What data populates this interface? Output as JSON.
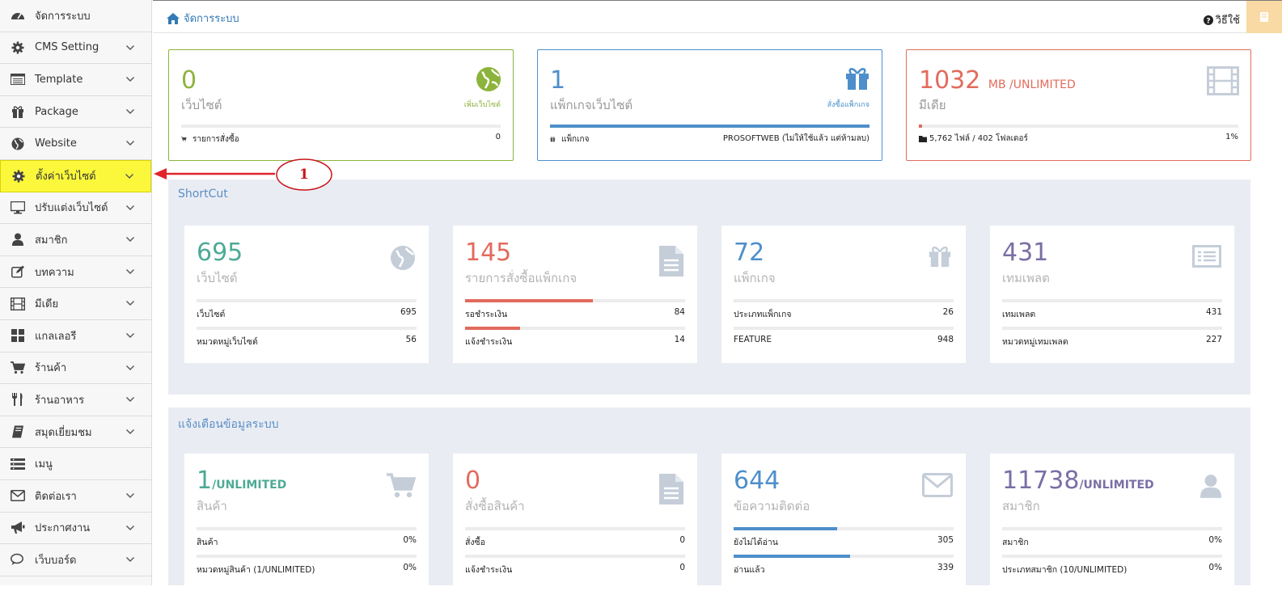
{
  "sidebar": {
    "items": [
      {
        "label": "จัดการระบบ",
        "icon": "dashboard-icon",
        "chevron": false
      },
      {
        "label": "CMS Setting",
        "icon": "gear-icon",
        "chevron": true
      },
      {
        "label": "Template",
        "icon": "template-list-icon",
        "chevron": true
      },
      {
        "label": "Package",
        "icon": "gift-icon",
        "chevron": true
      },
      {
        "label": "Website",
        "icon": "globe-icon",
        "chevron": true
      },
      {
        "label": "ตั้งค่าเว็บไซต์",
        "icon": "gear-icon",
        "chevron": true,
        "active": true
      },
      {
        "label": "ปรับแต่งเว็บไซต์",
        "icon": "monitor-icon",
        "chevron": true
      },
      {
        "label": "สมาชิก",
        "icon": "user-icon",
        "chevron": true
      },
      {
        "label": "บทความ",
        "icon": "edit-icon",
        "chevron": true
      },
      {
        "label": "มีเดีย",
        "icon": "film-icon",
        "chevron": true
      },
      {
        "label": "แกลเลอรี",
        "icon": "grid-icon",
        "chevron": true
      },
      {
        "label": "ร้านค้า",
        "icon": "cart-icon",
        "chevron": true
      },
      {
        "label": "ร้านอาหาร",
        "icon": "utensils-icon",
        "chevron": true
      },
      {
        "label": "สมุดเยี่ยมชม",
        "icon": "book-icon",
        "chevron": true
      },
      {
        "label": "เมนู",
        "icon": "menu-icon",
        "chevron": false
      },
      {
        "label": "ติดต่อเรา",
        "icon": "envelope-icon",
        "chevron": true
      },
      {
        "label": "ประกาศงาน",
        "icon": "megaphone-icon",
        "chevron": true
      },
      {
        "label": "เว็บบอร์ด",
        "icon": "comments-icon",
        "chevron": true
      }
    ]
  },
  "topbar": {
    "breadcrumb": "จัดการระบบ",
    "help": "วิธีใช้"
  },
  "callout": {
    "number": "1"
  },
  "top_cards": [
    {
      "value": "0",
      "unit": "",
      "label": "เว็บไซต์",
      "action": "เพิ่มเว็บไซต์",
      "foot_left": "รายการสั่งซื้อ",
      "foot_right": "0",
      "color": "#8cb43c",
      "fill": 0
    },
    {
      "value": "1",
      "unit": "",
      "label": "แพ็กเกจเว็บไซต์",
      "action": "สั่งซื้อแพ็กเกจ",
      "foot_left": "แพ็กเกจ",
      "foot_right": "PROSOFTWEB (ไม่ให้ใช้แล้ว แต่ห้ามลบ)",
      "color": "#4e8fcb",
      "fill": 1
    },
    {
      "value": "1032",
      "unit": "MB /UNLIMITED",
      "label": "มีเดีย",
      "action": "",
      "foot_left": "5,762 ไฟล์ / 402 โฟลเดอร์",
      "foot_right": "1%",
      "color": "#e26b5d",
      "fill": 0.01
    }
  ],
  "shortcut": {
    "title": "ShortCut",
    "cards": [
      {
        "value": "695",
        "label": "เว็บไซต์",
        "color": "#4eaa96",
        "icon": "globe-icon",
        "rows": [
          {
            "label": "เว็บไซต์",
            "value": "695",
            "fill": 0
          },
          {
            "label": "หมวดหมู่เว็บไซต์",
            "value": "56",
            "fill": 0
          }
        ]
      },
      {
        "value": "145",
        "label": "รายการสั่งซื้อแพ็กเกจ",
        "color": "#e26b5d",
        "icon": "document-icon",
        "rows": [
          {
            "label": "รอชำระเงิน",
            "value": "84",
            "fill": 0.58
          },
          {
            "label": "แจ้งชำระเงิน",
            "value": "14",
            "fill": 0.25
          }
        ]
      },
      {
        "value": "72",
        "label": "แพ็กเกจ",
        "color": "#4e8fcb",
        "icon": "gift-icon",
        "rows": [
          {
            "label": "ประเภทแพ็กเกจ",
            "value": "26",
            "fill": 0
          },
          {
            "label": "FEATURE",
            "value": "948",
            "fill": 0
          }
        ]
      },
      {
        "value": "431",
        "label": "เทมเพลต",
        "color": "#7b6ea5",
        "icon": "list-icon",
        "rows": [
          {
            "label": "เทมเพลต",
            "value": "431",
            "fill": 0
          },
          {
            "label": "หมวดหมู่เทมเพลต",
            "value": "227",
            "fill": 0
          }
        ]
      }
    ]
  },
  "alerts": {
    "title": "แจ้งเตือนข้อมูลระบบ",
    "cards": [
      {
        "value": "1",
        "unit": "/UNLIMITED",
        "label": "สินค้า",
        "color": "#4eaa96",
        "icon": "cart-icon",
        "rows": [
          {
            "label": "สินค้า",
            "value": "0%",
            "fill": 0
          },
          {
            "label": "หมวดหมู่สินค้า (1/UNLIMITED)",
            "value": "0%",
            "fill": 0
          }
        ]
      },
      {
        "value": "0",
        "unit": "",
        "label": "สั่งซื้อสินค้า",
        "color": "#e26b5d",
        "icon": "document-icon",
        "rows": [
          {
            "label": "สั่งซื้อ",
            "value": "0",
            "fill": 0
          },
          {
            "label": "แจ้งชำระเงิน",
            "value": "0",
            "fill": 0
          }
        ]
      },
      {
        "value": "644",
        "unit": "",
        "label": "ข้อความติดต่อ",
        "color": "#4e8fcb",
        "icon": "envelope-icon",
        "rows": [
          {
            "label": "ยังไม่ได้อ่าน",
            "value": "305",
            "fill": 0.47
          },
          {
            "label": "อ่านแล้ว",
            "value": "339",
            "fill": 0.53
          }
        ]
      },
      {
        "value": "11738",
        "unit": "/UNLIMITED",
        "label": "สมาชิก",
        "color": "#7b6ea5",
        "icon": "user-icon",
        "rows": [
          {
            "label": "สมาชิก",
            "value": "0%",
            "fill": 0
          },
          {
            "label": "ประเภทสมาชิก (10/UNLIMITED)",
            "value": "0%",
            "fill": 0
          }
        ]
      }
    ]
  }
}
